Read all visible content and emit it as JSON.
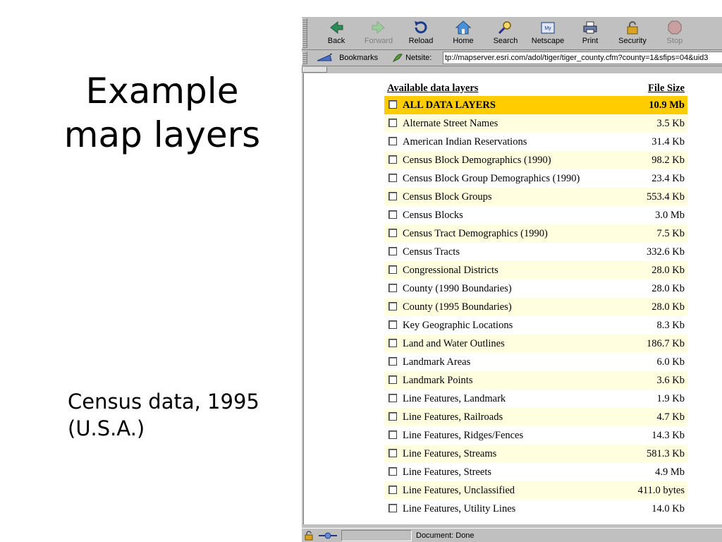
{
  "slide": {
    "title_line1": "Example",
    "title_line2": "map layers",
    "caption_line1": "Census data, 1995",
    "caption_line2": "(U.S.A.)"
  },
  "browser": {
    "toolbar": {
      "back": "Back",
      "forward": "Forward",
      "reload": "Reload",
      "home": "Home",
      "search": "Search",
      "netscape": "Netscape",
      "print": "Print",
      "security": "Security",
      "stop": "Stop"
    },
    "bookmarks_label": "Bookmarks",
    "netsite_label": "Netsite:",
    "url": "tp://mapserver.esri.com/adol/tiger/tiger_county.cfm?county=1&sfips=04&uid3",
    "status_text": "Document: Done"
  },
  "layers_table": {
    "header_name": "Available data layers",
    "header_size": "File Size",
    "all_row": {
      "name": "ALL DATA LAYERS",
      "size": "10.9 Mb"
    },
    "rows": [
      {
        "name": "Alternate Street Names",
        "size": "3.5 Kb"
      },
      {
        "name": "American Indian Reservations",
        "size": "31.4 Kb"
      },
      {
        "name": "Census Block Demographics (1990)",
        "size": "98.2 Kb"
      },
      {
        "name": "Census Block Group Demographics (1990)",
        "size": "23.4 Kb"
      },
      {
        "name": "Census Block Groups",
        "size": "553.4 Kb"
      },
      {
        "name": "Census Blocks",
        "size": "3.0 Mb"
      },
      {
        "name": "Census Tract Demographics (1990)",
        "size": "7.5 Kb"
      },
      {
        "name": "Census Tracts",
        "size": "332.6 Kb"
      },
      {
        "name": "Congressional Districts",
        "size": "28.0 Kb"
      },
      {
        "name": "County (1990 Boundaries)",
        "size": "28.0 Kb"
      },
      {
        "name": "County (1995 Boundaries)",
        "size": "28.0 Kb"
      },
      {
        "name": "Key Geographic Locations",
        "size": "8.3 Kb"
      },
      {
        "name": "Land and Water Outlines",
        "size": "186.7 Kb"
      },
      {
        "name": "Landmark Areas",
        "size": "6.0 Kb"
      },
      {
        "name": "Landmark Points",
        "size": "3.6 Kb"
      },
      {
        "name": "Line Features, Landmark",
        "size": "1.9 Kb"
      },
      {
        "name": "Line Features, Railroads",
        "size": "4.7 Kb"
      },
      {
        "name": "Line Features, Ridges/Fences",
        "size": "14.3 Kb"
      },
      {
        "name": "Line Features, Streams",
        "size": "581.3 Kb"
      },
      {
        "name": "Line Features, Streets",
        "size": "4.9 Mb"
      },
      {
        "name": "Line Features, Unclassified",
        "size": "411.0 bytes"
      },
      {
        "name": "Line Features, Utility Lines",
        "size": "14.0 Kb"
      }
    ]
  }
}
